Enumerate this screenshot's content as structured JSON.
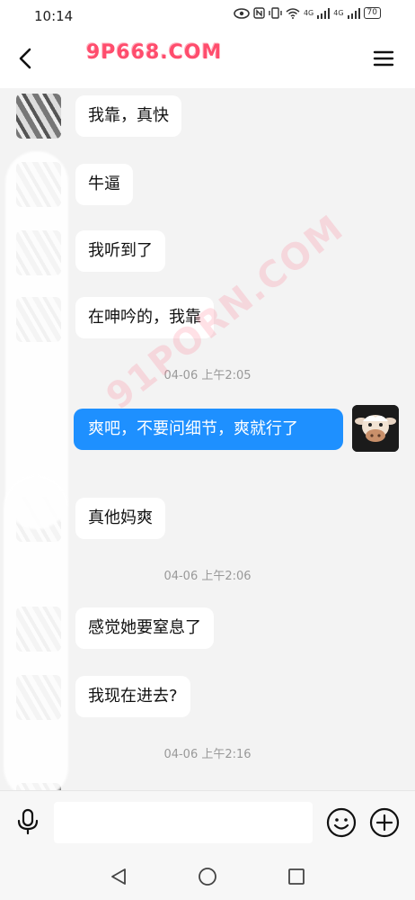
{
  "status_bar": {
    "time": "10:14",
    "icons": [
      "eye-icon",
      "nfc-icon",
      "vibrate-icon",
      "wifi-icon",
      "signal-icon",
      "signal-icon"
    ],
    "network_1": "4G",
    "network_2": "4G",
    "battery": "70"
  },
  "header": {
    "title": "9P668.COM"
  },
  "watermark": "91PORN.COM",
  "messages": [
    {
      "type": "in",
      "text": "我靠，真快"
    },
    {
      "type": "in",
      "text": "牛逼"
    },
    {
      "type": "in",
      "text": "我听到了"
    },
    {
      "type": "in",
      "text": "在呻吟的，我靠"
    },
    {
      "type": "time",
      "text": "04-06 上午2:05"
    },
    {
      "type": "out",
      "text": "爽吧，不要问细节，爽就行了"
    },
    {
      "type": "in",
      "text": "真他妈爽"
    },
    {
      "type": "time",
      "text": "04-06 上午2:06"
    },
    {
      "type": "in",
      "text": "感觉她要窒息了"
    },
    {
      "type": "in",
      "text": "我现在进去?"
    },
    {
      "type": "time",
      "text": "04-06 上午2:16"
    }
  ],
  "input": {
    "placeholder": ""
  },
  "colors": {
    "outgoing_bubble": "#1e90ff",
    "incoming_bubble": "#ffffff",
    "chat_background": "#f3f3f3",
    "title": "#ff4d6d"
  }
}
